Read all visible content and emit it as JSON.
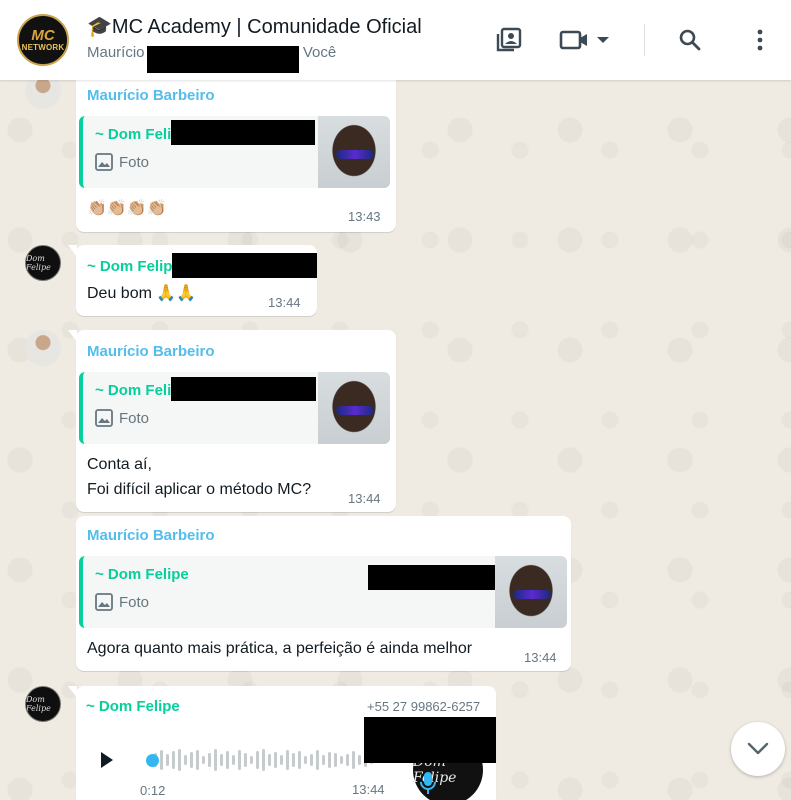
{
  "header": {
    "group_logo_line1": "MC",
    "group_logo_line2": "NETWORK",
    "title": "🎓MC Academy | Comunidade Oficial",
    "subtitle_start": "Maurício",
    "subtitle_end": ", Você",
    "icons": [
      "group-media-icon",
      "video-call-icon",
      "chevron-down-icon",
      "search-icon",
      "more-options-icon"
    ]
  },
  "messages": [
    {
      "sender": "Maurício Barbeiro",
      "quote": {
        "name": "~ Dom Feli",
        "type": "Foto"
      },
      "text": "👏🏼👏🏼👏🏼👏🏼",
      "time": "13:43"
    },
    {
      "sender": "~ Dom Felip",
      "text": "Deu bom 🙏🙏",
      "time": "13:44"
    },
    {
      "sender": "Maurício Barbeiro",
      "quote": {
        "name": "~ Dom Feli",
        "type": "Foto"
      },
      "text_line1": "Conta aí,",
      "text_line2": "Foi difícil aplicar o método MC?",
      "time": "13:44"
    },
    {
      "sender": "Maurício Barbeiro",
      "quote": {
        "name": "~ Dom Felipe",
        "type": "Foto"
      },
      "text": "Agora quanto mais prática, a perfeição é ainda melhor",
      "time": "13:44"
    },
    {
      "sender": "~ Dom Felipe",
      "phone": "+55 27 99862-6257",
      "voice_avatar_text": "Dom Felipe",
      "duration": "0:12",
      "time": "13:44"
    }
  ],
  "colors": {
    "chat_bg": "#efeae2",
    "accent_green": "#06cf9c",
    "accent_blue": "#53bdeb",
    "meta_gray": "#667781"
  },
  "avatar_felipe_text": "Dom Felipe"
}
